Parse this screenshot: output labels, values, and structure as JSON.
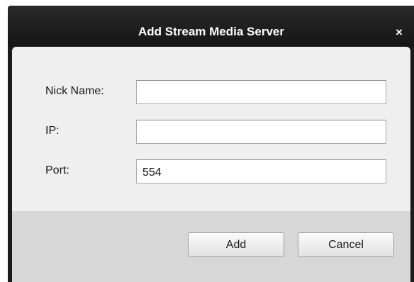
{
  "dialog": {
    "title": "Add Stream Media Server",
    "close_label": "×"
  },
  "form": {
    "nick_name": {
      "label": "Nick Name:",
      "value": ""
    },
    "ip": {
      "label": "IP:",
      "value": ""
    },
    "port": {
      "label": "Port:",
      "value": "554"
    }
  },
  "buttons": {
    "add_label": "Add",
    "cancel_label": "Cancel"
  },
  "colors": {
    "title_bar": "#1b1b1b",
    "title_text": "#ffffff",
    "content_bg": "#efefef",
    "footer_bg": "#d7d7d7"
  }
}
